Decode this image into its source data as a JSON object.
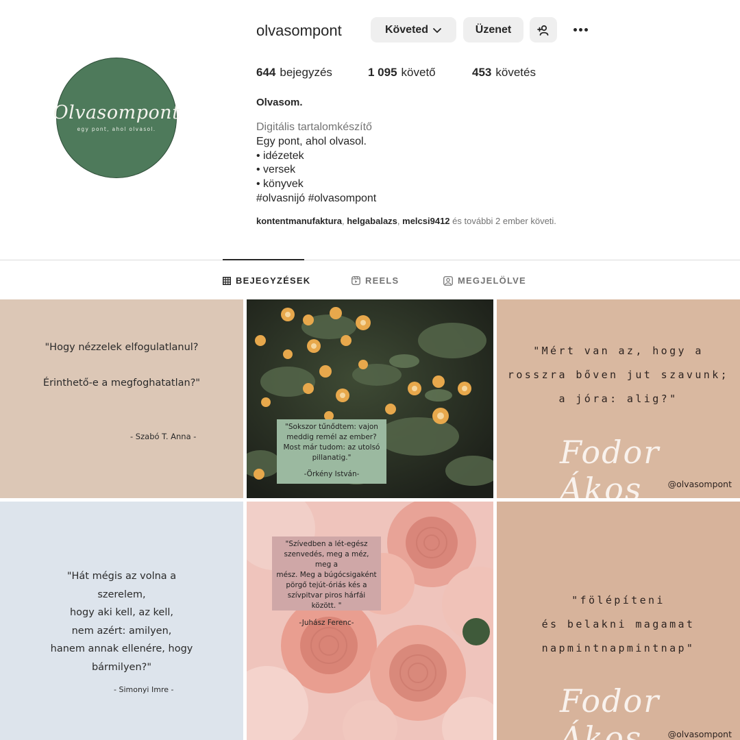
{
  "profile": {
    "avatar_text": "Olvasompont",
    "avatar_tagline": "egy pont, ahol olvasol.",
    "username": "olvasompont",
    "follow_button": "Követed",
    "message_button": "Üzenet",
    "stats": {
      "posts_value": "644",
      "posts_label": "bejegyzés",
      "followers_value": "1 095",
      "followers_label": "követő",
      "following_value": "453",
      "following_label": "követés"
    },
    "full_name": "Olvasom.",
    "bio": {
      "category": "Digitális tartalomkészítő",
      "line1": "Egy pont, ahol olvasol.",
      "line2": "• idézetek",
      "line3": "• versek",
      "line4": "• könyvek",
      "line5": "#olvasnijó #olvasompont"
    },
    "followed_by": {
      "user1": "kontentmanufaktura",
      "user2": "helgabalazs",
      "user3": "melcsi9412",
      "suffix": " és további 2 ember követi."
    }
  },
  "tabs": {
    "posts": "BEJEGYZÉSEK",
    "reels": "REELS",
    "tagged": "MEGJELÖLVE"
  },
  "posts": {
    "p1": {
      "line1": "\"Hogy nézzelek elfogulatlanul?",
      "line2": "Érinthető-e a megfoghatatlan?\"",
      "author": "-  Szabó T. Anna -"
    },
    "p2": {
      "l1": "\"Sokszor tűnődtem: vajon",
      "l2": "meddig remél az ember?",
      "l3": "Most már tudom: az utolsó",
      "l4": "pillanatig.\"",
      "author": "-Örkény István-"
    },
    "p3": {
      "l1": "\"Mért van az, hogy a",
      "l2": "rosszra bőven jut szavunk;",
      "l3": "a jóra: alig?\"",
      "signature": "Fodor Ákos",
      "handle": "@olvasompont"
    },
    "p4": {
      "l1": "\"Hát mégis az volna a",
      "l2": "szerelem,",
      "l3": "hogy aki kell, az kell,",
      "l4": "nem azért: amilyen,",
      "l5": "hanem annak ellenére, hogy",
      "l6": "bármilyen?\"",
      "author": "- Simonyi Imre -"
    },
    "p5": {
      "l1": "\"Szívedben a lét-egész",
      "l2": "szenvedés, meg a méz, meg a",
      "l3": "mész. Meg a búgócsigaként",
      "l4": "pörgő tejút-óriás kés a",
      "l5": "szívpitvar piros hárfái között. \"",
      "author": "-Juhász Ferenc-"
    },
    "p6": {
      "l1": "\"fölépíteni",
      "l2": "és belakni magamat",
      "l3": "napmintnapmintnap\"",
      "signature": "Fodor Ákos",
      "handle": "@olvasompont"
    }
  },
  "colors": {
    "avatar_green": "#4e7a5b",
    "beige": "#dcc7b6",
    "sage_card": "#9bb9a0",
    "pink_card": "#cfa7a7",
    "light_blue": "#dde4ec"
  }
}
